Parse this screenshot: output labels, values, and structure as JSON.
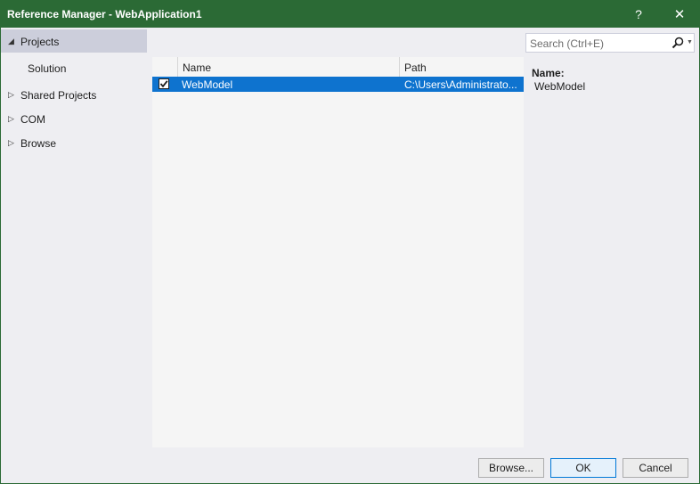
{
  "window": {
    "title": "Reference Manager - WebApplication1",
    "help_glyph": "?",
    "close_glyph": "✕"
  },
  "sidebar": {
    "items": [
      {
        "label": "Projects",
        "expanded": true,
        "selected": true
      },
      {
        "label": "Solution",
        "child": true
      },
      {
        "label": "Shared Projects",
        "expanded": false
      },
      {
        "label": "COM",
        "expanded": false
      },
      {
        "label": "Browse",
        "expanded": false
      }
    ],
    "expanded_glyph": "◢",
    "collapsed_glyph": "▷"
  },
  "list": {
    "columns": {
      "name": "Name",
      "path": "Path"
    },
    "rows": [
      {
        "checked": true,
        "name": "WebModel",
        "path": "C:\\Users\\Administrato..."
      }
    ]
  },
  "search": {
    "placeholder": "Search (Ctrl+E)",
    "dropdown_glyph": "▼"
  },
  "details": {
    "name_label": "Name:",
    "name_value": "WebModel"
  },
  "buttons": {
    "browse": "Browse...",
    "ok": "OK",
    "cancel": "Cancel"
  },
  "colors": {
    "titlebar": "#2b6a35",
    "selection": "#0e73cf",
    "sidebar_selected": "#cccedb"
  }
}
